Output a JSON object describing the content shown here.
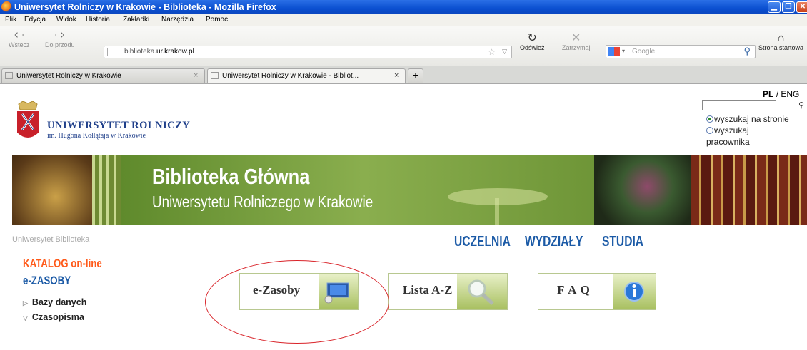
{
  "window": {
    "title": "Uniwersytet Rolniczy w Krakowie - Biblioteka - Mozilla Firefox"
  },
  "menu": [
    "Plik",
    "Edycja",
    "Widok",
    "Historia",
    "Zakładki",
    "Narzędzia",
    "Pomoc"
  ],
  "toolbar": {
    "back": "Wstecz",
    "forward": "Do przodu",
    "url_prefix": "biblioteka.",
    "url_domain": "ur.krakow.pl",
    "reload": "Odśwież",
    "stop": "Zatrzymaj",
    "search_placeholder": "Google",
    "home": "Strona startowa"
  },
  "tabs": [
    {
      "label": "Uniwersytet Rolniczy w Krakowie"
    },
    {
      "label": "Uniwersytet Rolniczy w Krakowie - Bibliot..."
    }
  ],
  "page": {
    "lang_pl": "PL",
    "lang_sep": "/",
    "lang_eng": "ENG",
    "radio_site": "wyszukaj na stronie",
    "radio_staff_1": "wyszukaj",
    "radio_staff_2": "pracownika",
    "uni_name": "UNIWERSYTET ROLNICZY",
    "uni_sub": "im. Hugona Kołłątaja w Krakowie",
    "banner_title": "Biblioteka Główna",
    "banner_subtitle": "Uniwersytetu Rolniczego w Krakowie",
    "breadcrumb": [
      "Uniwersytet",
      "Biblioteka"
    ],
    "topnav": [
      "UCZELNIA",
      "WYDZIAŁY",
      "STUDIA"
    ],
    "sidebar": {
      "katalog": "KATALOG on-line",
      "ezasoby": "e-ZASOBY",
      "items": [
        "Bazy danych",
        "Czasopisma"
      ]
    },
    "buttons": [
      "e-Zasoby",
      "Lista A-Z",
      "F A Q"
    ]
  }
}
